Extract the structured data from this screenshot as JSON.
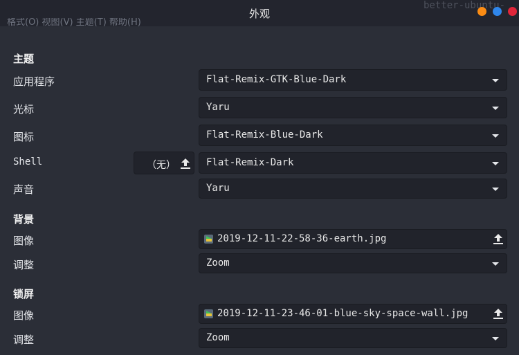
{
  "window": {
    "title": "外观",
    "background_menu": "格式(O)  视图(V)  主题(T)  帮助(H)",
    "background_text": "better-ubuntu-"
  },
  "colors": {
    "min_button": "#fb8c14",
    "max_button": "#2f86eb",
    "close_button": "#e0263a",
    "background": "#2b2e37",
    "field": "#21232b"
  },
  "themes": {
    "heading": "主题",
    "applications": {
      "label": "应用程序",
      "value": "Flat-Remix-GTK-Blue-Dark"
    },
    "cursor": {
      "label": "光标",
      "value": "Yaru"
    },
    "icons": {
      "label": "图标",
      "value": "Flat-Remix-Blue-Dark"
    },
    "shell": {
      "label": "Shell",
      "button": "（无）",
      "value": "Flat-Remix-Dark"
    },
    "sound": {
      "label": "声音",
      "value": "Yaru"
    }
  },
  "background": {
    "heading": "背景",
    "image": {
      "label": "图像",
      "value": "2019-12-11-22-58-36-earth.jpg"
    },
    "adjust": {
      "label": "调整",
      "value": "Zoom"
    }
  },
  "lock_screen": {
    "heading": "锁屏",
    "image": {
      "label": "图像",
      "value": "2019-12-11-23-46-01-blue-sky-space-wall.jpg"
    },
    "adjust": {
      "label": "调整",
      "value": "Zoom"
    }
  },
  "icons": {
    "dropdown": "chevron-down-icon",
    "upload": "upload-icon",
    "image_file": "image-file-icon"
  }
}
